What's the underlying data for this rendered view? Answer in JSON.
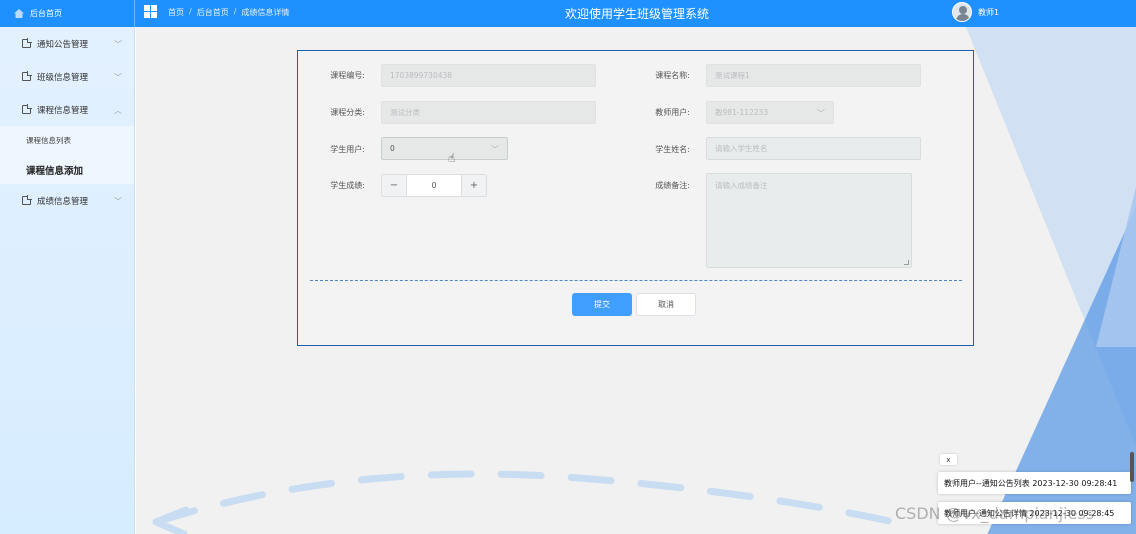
{
  "topbar": {
    "brand": "后台首页",
    "breadcrumb": [
      "首页",
      "后台首页",
      "成绩信息详情"
    ],
    "title": "欢迎使用学生班级管理系统",
    "user": "教师1"
  },
  "sidebar": {
    "items": [
      {
        "label": "通知公告管理"
      },
      {
        "label": "班级信息管理"
      },
      {
        "label": "课程信息管理"
      },
      {
        "label": "成绩信息管理"
      }
    ],
    "submenu": [
      {
        "label": "课程信息列表"
      },
      {
        "label": "课程信息添加"
      }
    ]
  },
  "form": {
    "course_no_label": "课程编号:",
    "course_no_value": "1703899730438",
    "course_name_label": "课程名称:",
    "course_name_value": "测试课程1",
    "category_label": "课程分类:",
    "category_value": "测试分类",
    "teacher_label": "教师用户:",
    "teacher_value": "教981-112233",
    "student_user_label": "学生用户:",
    "student_user_value": "0",
    "student_name_label": "学生姓名:",
    "student_name_placeholder": "请输入学生姓名",
    "score_label": "学生成绩:",
    "score_value": "0",
    "score_minus": "−",
    "score_plus": "+",
    "remark_label": "成绩备注:",
    "remark_placeholder": "请输入成绩备注",
    "submit": "提交",
    "cancel": "取消"
  },
  "notifications": {
    "close": "x",
    "items": [
      "教师用户--通知公告列表 2023-12-30 09:28:41",
      "教师用户-通知公告详情 2023-12-30 09:28:45"
    ]
  },
  "watermark": "CSDN @vx_dampianjiess"
}
